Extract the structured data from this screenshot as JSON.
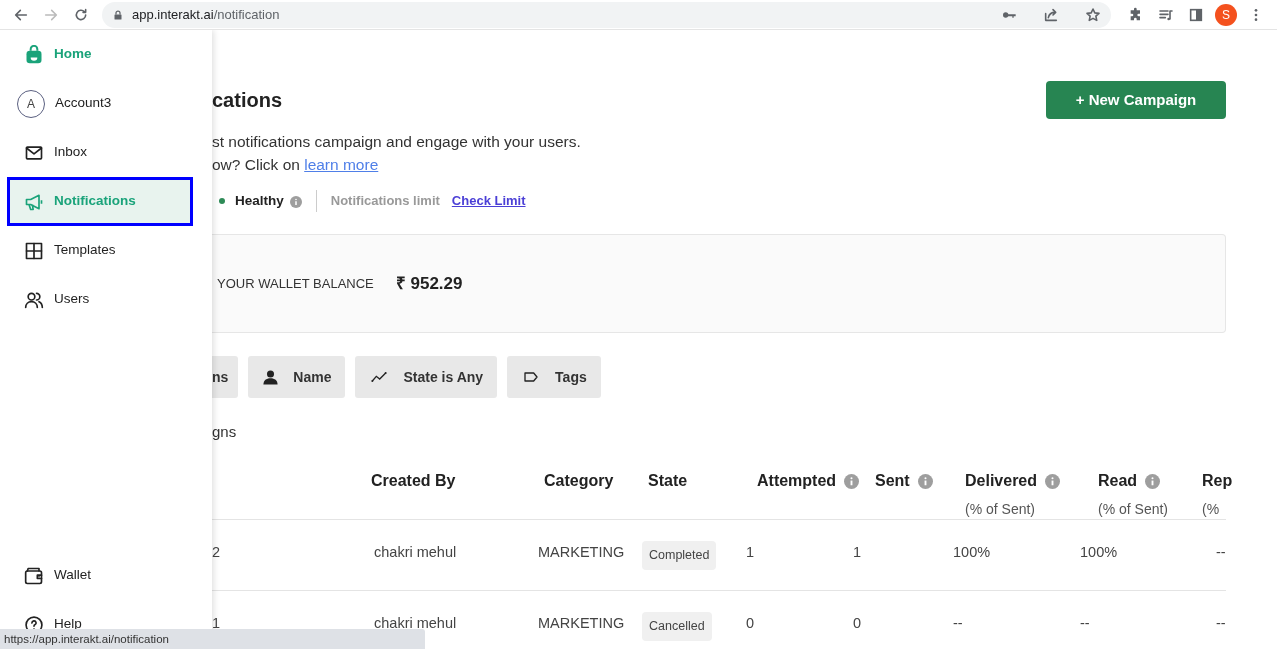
{
  "browser": {
    "url_host": "app.interakt.ai",
    "url_path": "/notification",
    "profile_initial": "S",
    "forward_disabled": true
  },
  "sidebar": {
    "items": [
      {
        "kind": "brand",
        "label": "Home",
        "selected": false
      },
      {
        "kind": "account",
        "label": "Account3",
        "avatar": "A",
        "selected": false
      },
      {
        "kind": "link",
        "label": "Inbox",
        "selected": false
      },
      {
        "kind": "link",
        "label": "Notifications",
        "selected": true
      },
      {
        "kind": "link",
        "label": "Templates",
        "selected": false
      },
      {
        "kind": "link",
        "label": "Users",
        "selected": false
      }
    ],
    "bottom_items": [
      {
        "label": "Wallet"
      },
      {
        "label": "Help"
      }
    ]
  },
  "page": {
    "title": "cations",
    "new_campaign_button": "+ New Campaign",
    "description": "st notifications campaign and engage with your users.",
    "help_text": "ow? Click on",
    "help_link": "learn more",
    "health": "Healthy",
    "limit_label": "Notifications limit",
    "limit_link": "Check Limit"
  },
  "wallet": {
    "label": "YOUR WALLET BALANCE",
    "amount": "₹ 952.29"
  },
  "filters": [
    {
      "label": "ns"
    },
    {
      "label": "Name"
    },
    {
      "label": "State is Any"
    },
    {
      "label": "Tags"
    }
  ],
  "list_title": "gns",
  "table": {
    "columns": [
      {
        "label": "Created By",
        "info": false
      },
      {
        "label": "Category",
        "info": false
      },
      {
        "label": "State",
        "info": false
      },
      {
        "label": "Attempted",
        "info": true
      },
      {
        "label": "Sent",
        "info": true
      },
      {
        "label": "Delivered",
        "sub": "(% of Sent)",
        "info": true
      },
      {
        "label": "Read",
        "sub": "(% of Sent)",
        "info": true
      },
      {
        "label": "Rep",
        "sub": "(%"
      }
    ],
    "rows": [
      {
        "column_1": "2",
        "created_by": "chakri mehul",
        "category": "MARKETING",
        "state": "Completed",
        "attempted": "1",
        "sent": "1",
        "delivered": "100%",
        "read": "100%",
        "column_9": "--"
      },
      {
        "column_1": "1",
        "created_by": "chakri mehul",
        "category": "MARKETING",
        "state": "Cancelled",
        "attempted": "0",
        "sent": "0",
        "delivered": "--",
        "read": "--",
        "column_9": "--"
      }
    ]
  },
  "status_tooltip": "https://app.interakt.ai/notification"
}
